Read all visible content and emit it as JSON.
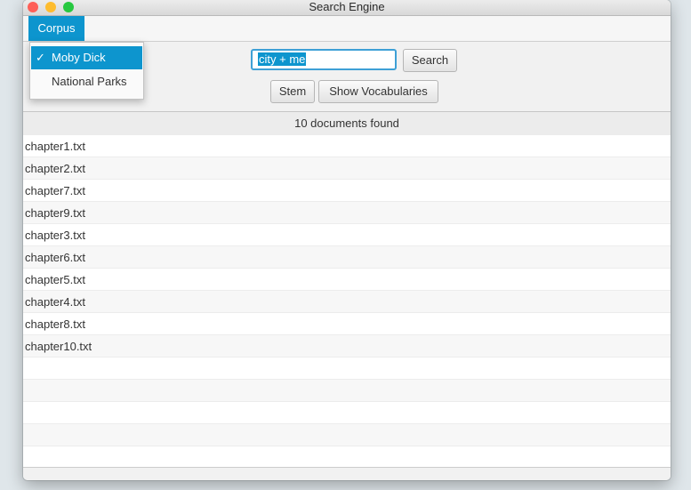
{
  "window": {
    "title": "Search Engine",
    "controls": [
      {
        "name": "close",
        "color": "#fe5f57"
      },
      {
        "name": "minimize",
        "color": "#febc2e"
      },
      {
        "name": "zoom",
        "color": "#28c840"
      }
    ]
  },
  "menu": {
    "corpus_label": "Corpus",
    "items": [
      {
        "label": "Moby Dick",
        "checked": true,
        "check_mark": "✓"
      },
      {
        "label": "National Parks",
        "checked": false,
        "check_mark": ""
      }
    ]
  },
  "search": {
    "value": "city + me",
    "search_label": "Search",
    "stem_label": "Stem",
    "vocab_label": "Show Vocabularies"
  },
  "results": {
    "status": "10 documents found",
    "files": [
      "chapter1.txt",
      "chapter2.txt",
      "chapter7.txt",
      "chapter9.txt",
      "chapter3.txt",
      "chapter6.txt",
      "chapter5.txt",
      "chapter4.txt",
      "chapter8.txt",
      "chapter10.txt"
    ]
  },
  "colors": {
    "accent": "#0d95ce",
    "focus_ring": "#3ea0d6"
  }
}
